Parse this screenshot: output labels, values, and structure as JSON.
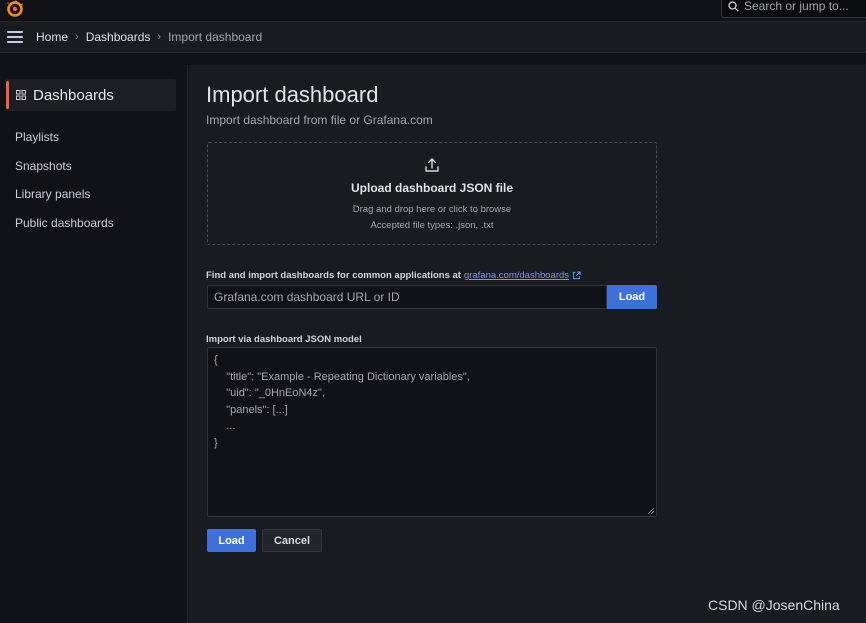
{
  "topbar": {
    "search_placeholder": "Search or jump to..."
  },
  "breadcrumb": {
    "home": "Home",
    "separator": "›",
    "dashboards": "Dashboards",
    "current": "Import dashboard"
  },
  "sidebar": {
    "section_title": "Dashboards",
    "items": [
      {
        "label": "Playlists"
      },
      {
        "label": "Snapshots"
      },
      {
        "label": "Library panels"
      },
      {
        "label": "Public dashboards"
      }
    ]
  },
  "main": {
    "title": "Import dashboard",
    "subtitle": "Import dashboard from file or Grafana.com",
    "upload": {
      "title": "Upload dashboard JSON file",
      "hint": "Drag and drop here or click to browse",
      "accepted": "Accepted file types: .json, .txt"
    },
    "grafana_com": {
      "label": "Find and import dashboards for common applications at",
      "link": "grafana.com/dashboards",
      "placeholder": "Grafana.com dashboard URL or ID",
      "load_label": "Load"
    },
    "json_model": {
      "label": "Import via dashboard JSON model",
      "lines": [
        "{",
        "    \"title\": \"Example - Repeating Dictionary variables\",",
        "    \"uid\": \"_0HnEoN4z\",",
        "    \"panels\": [...]",
        "    ...",
        "}"
      ]
    },
    "actions": {
      "load_label": "Load",
      "cancel_label": "Cancel"
    }
  },
  "watermark": "CSDN @JosenChina",
  "colors": {
    "accent": "#f55f3e",
    "primary_button": "#3d71d9",
    "link": "#6e9fff",
    "background": "#111217",
    "panel": "#181b1f"
  }
}
